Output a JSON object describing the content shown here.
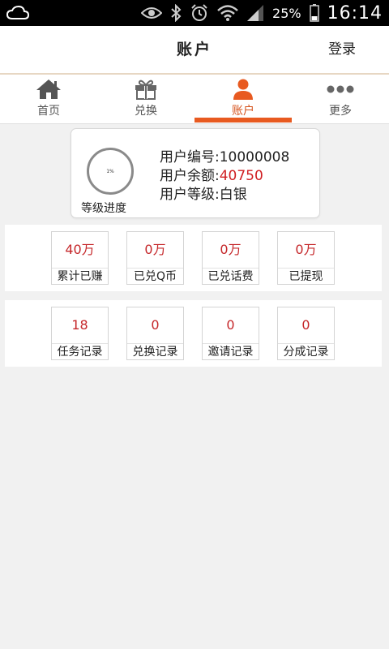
{
  "status_bar": {
    "battery_percent": "25%",
    "time": "16:14"
  },
  "header": {
    "title": "账户",
    "login_label": "登录"
  },
  "tabs": [
    {
      "label": "首页",
      "icon": "home-icon"
    },
    {
      "label": "兑换",
      "icon": "gift-icon"
    },
    {
      "label": "账户",
      "icon": "user-icon",
      "active": true
    },
    {
      "label": "更多",
      "icon": "more-icon"
    }
  ],
  "account": {
    "progress_percent": "1%",
    "progress_label": "等级进度",
    "id_label": "用户编号:",
    "id_value": "10000008",
    "balance_label": "用户余额:",
    "balance_value": "40750",
    "level_label": "用户等级:",
    "level_value": "白银"
  },
  "stats_row1": [
    {
      "value": "40万",
      "label": "累计已赚"
    },
    {
      "value": "0万",
      "label": "已兑Q币"
    },
    {
      "value": "0万",
      "label": "已兑话费"
    },
    {
      "value": "0万",
      "label": "已提现"
    }
  ],
  "stats_row2": [
    {
      "value": "18",
      "label": "任务记录"
    },
    {
      "value": "0",
      "label": "兑换记录"
    },
    {
      "value": "0",
      "label": "邀请记录"
    },
    {
      "value": "0",
      "label": "分成记录"
    }
  ],
  "colors": {
    "accent": "#e85a20",
    "value_red": "#c5272a"
  }
}
